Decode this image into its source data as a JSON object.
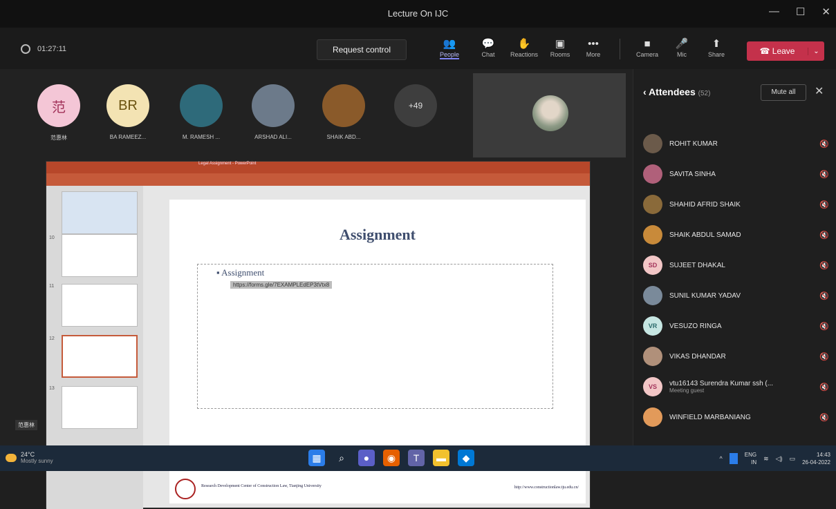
{
  "window": {
    "title": "Lecture On IJC",
    "controls": [
      "—",
      "☐",
      "✕"
    ]
  },
  "toolbar": {
    "timer": "01:27:11",
    "request_control": "Request control",
    "buttons": [
      {
        "label": "People",
        "icon": "people-icon"
      },
      {
        "label": "Chat",
        "icon": "chat-icon"
      },
      {
        "label": "Reactions",
        "icon": "reactions-icon"
      },
      {
        "label": "Rooms",
        "icon": "rooms-icon"
      },
      {
        "label": "More",
        "icon": "more-icon"
      },
      {
        "label": "Camera",
        "icon": "camera-icon"
      },
      {
        "label": "Mic",
        "icon": "mic-icon"
      },
      {
        "label": "Share",
        "icon": "share-icon"
      }
    ],
    "leave": "Leave"
  },
  "stage": {
    "participants": [
      {
        "initials": "范",
        "name": "范惠林",
        "color": "#f4c6d6",
        "text_color": "#a2335a"
      },
      {
        "initials": "BR",
        "name": "BA RAMEEZ... ",
        "color": "#f3e3b3",
        "text_color": "#6b5310"
      },
      {
        "initials": "",
        "name": "M. RAMESH ...",
        "color": "#2e6a7a",
        "text_color": "#fff"
      },
      {
        "initials": "",
        "name": "ARSHAD ALI...",
        "color": "#6c7a8a",
        "text_color": "#fff"
      },
      {
        "initials": "",
        "name": "SHAIK ABD...",
        "color": "#8a5a2a",
        "text_color": "#fff"
      }
    ],
    "overflow": "+49",
    "self_badge": "范惠林"
  },
  "presentation": {
    "ribbon_title": "Legal Assignment - PowerPoint",
    "thumb_numbers": [
      "10",
      "11",
      "12",
      "13"
    ],
    "slide_title": "Assignment",
    "bullet1": "Assignment",
    "bullet2": "https://forms.gle/7EXAMPLEdEP3tVtx8",
    "footer_text": "Research Development Center of Construction Law, Tianjing University",
    "footer_url": "http://www.constructionlaw.tju.edu.cn/"
  },
  "attendees": {
    "title": "Attendees",
    "count": "(52)",
    "mute_all": "Mute all",
    "list": [
      {
        "initials": "",
        "name": "ROHIT KUMAR",
        "sub": "",
        "color": "#6b5a4a"
      },
      {
        "initials": "",
        "name": "SAVITA SINHA",
        "sub": "",
        "color": "#b0607a"
      },
      {
        "initials": "",
        "name": "SHAHID AFRID SHAIK",
        "sub": "",
        "color": "#8a6a3a"
      },
      {
        "initials": "",
        "name": "SHAIK ABDUL SAMAD",
        "sub": "",
        "color": "#c88a3a"
      },
      {
        "initials": "SD",
        "name": "SUJEET DHAKAL",
        "sub": "",
        "color": "#f2c6c6"
      },
      {
        "initials": "",
        "name": "SUNIL KUMAR YADAV",
        "sub": "",
        "color": "#7a8a9a"
      },
      {
        "initials": "VR",
        "name": "VESUZO RINGA",
        "sub": "",
        "color": "#c6e6e2"
      },
      {
        "initials": "",
        "name": "VIKAS DHANDAR",
        "sub": "",
        "color": "#b0907a"
      },
      {
        "initials": "VS",
        "name": "vtu16143 Surendra Kumar ssh (...",
        "sub": "Meeting guest",
        "color": "#f2c6c6"
      },
      {
        "initials": "",
        "name": "WINFIELD MARBANIANG",
        "sub": "",
        "color": "#e29a5a"
      }
    ]
  },
  "taskbar": {
    "weather_temp": "24°C",
    "weather_desc": "Mostly sunny",
    "lang1": "ENG",
    "lang2": "IN",
    "time": "14:43",
    "date": "26-04-2022"
  }
}
